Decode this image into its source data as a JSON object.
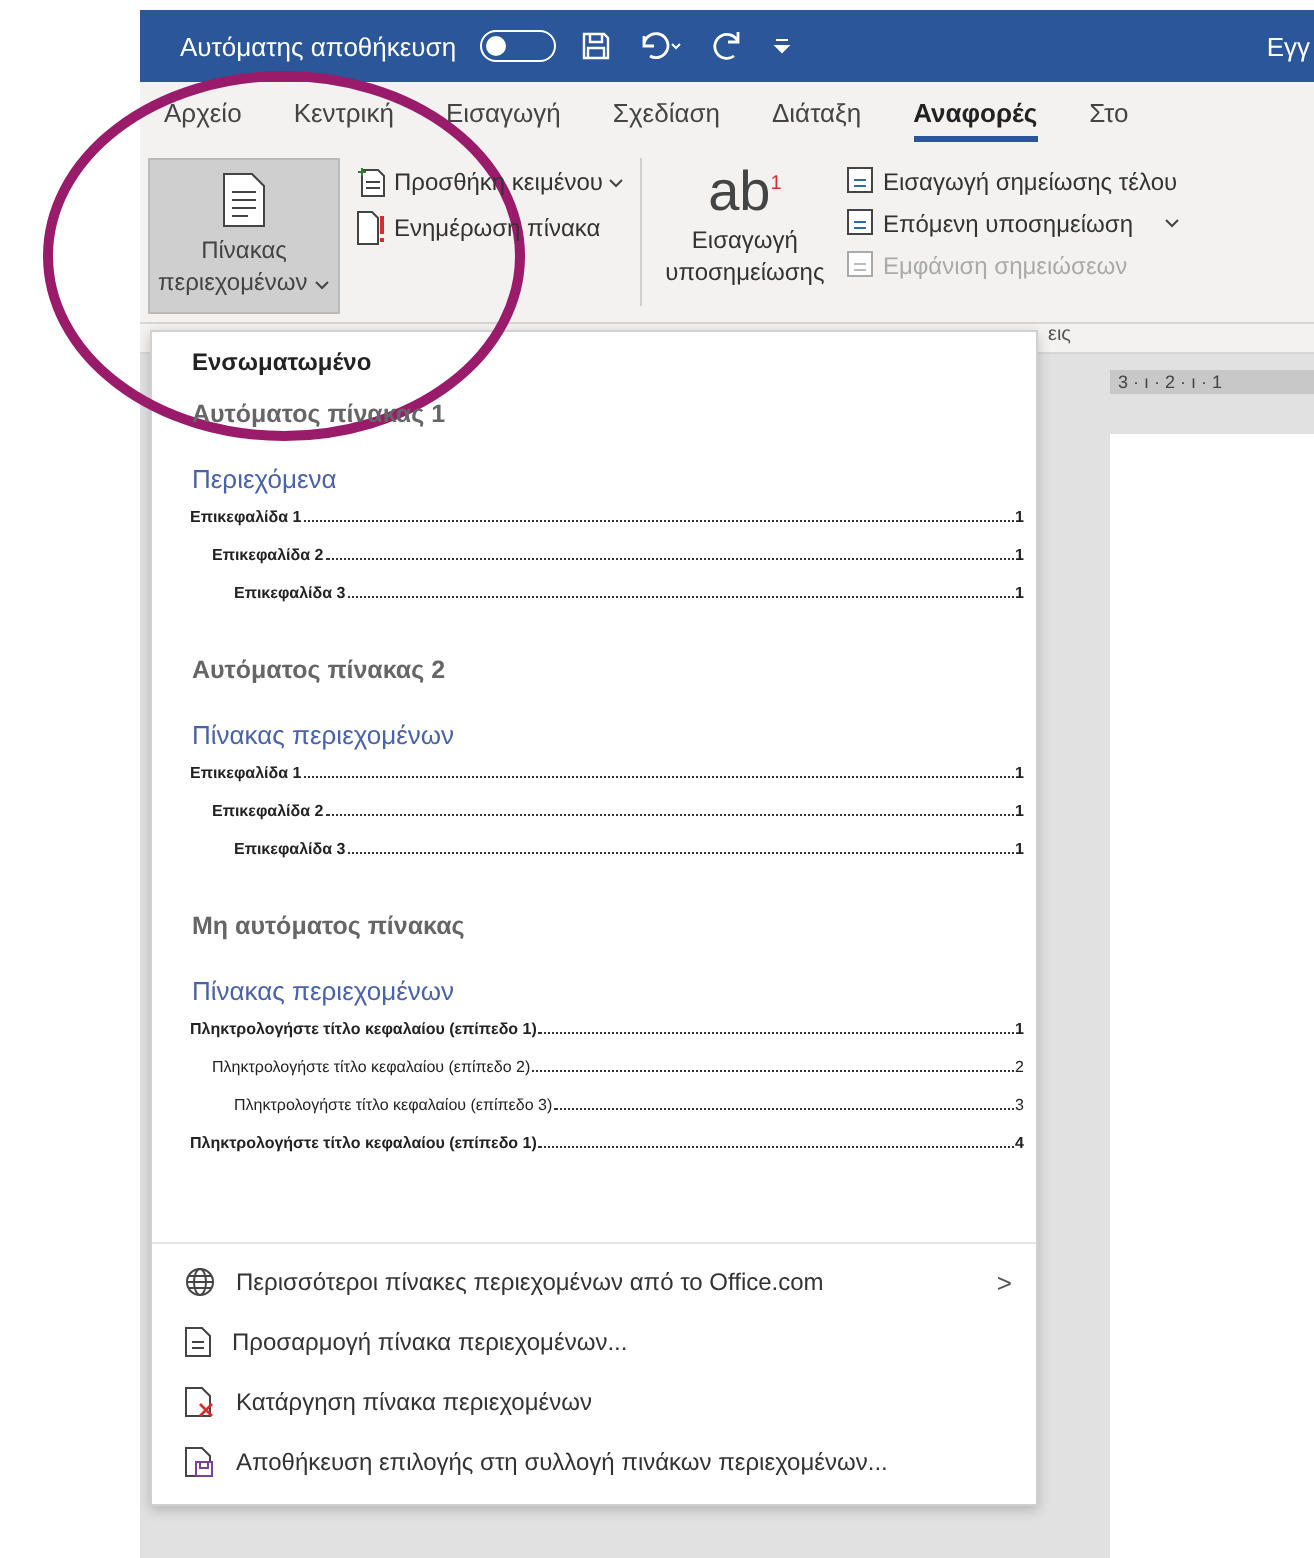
{
  "title_bar": {
    "autosave_label": "Αυτόματης αποθήκευση",
    "autosave_on": false,
    "title": "Εγγ"
  },
  "tabs": [
    {
      "label": "Αρχείο",
      "selected": false
    },
    {
      "label": "Κεντρική",
      "selected": false
    },
    {
      "label": "Εισαγωγή",
      "selected": false
    },
    {
      "label": "Σχεδίαση",
      "selected": false
    },
    {
      "label": "Διάταξη",
      "selected": false
    },
    {
      "label": "Αναφορές",
      "selected": true
    },
    {
      "label": "Στο",
      "selected": false
    }
  ],
  "ribbon": {
    "toc_button": {
      "label": "Πίνακας περιεχομένων",
      "pressed": true
    },
    "add_text": "Προσθήκη κειμένου",
    "update_table": "Ενημέρωση πίνακα",
    "footnote_glyph": "ab",
    "footnote_mark": "1",
    "insert_footnote": "Εισαγωγή υποσημείωσης",
    "small_items": [
      {
        "label": "Εισαγωγή σημείωσης τέλου",
        "disabled": false,
        "dropdown": false
      },
      {
        "label": "Επόμενη υποσημείωση",
        "disabled": false,
        "dropdown": true
      },
      {
        "label": "Εμφάνιση σημειώσεων",
        "disabled": true,
        "dropdown": false
      }
    ],
    "group_label": "εις"
  },
  "ruler": "3 · ı · 2 · ı · 1",
  "menu": {
    "header": "Ενσωματωμένο",
    "styles": [
      {
        "title": "Αυτόματος πίνακας 1",
        "heading": "Περιεχόμενα",
        "entries": [
          {
            "text": "Επικεφαλίδα 1",
            "page": "1",
            "bold": true,
            "children": [
              {
                "text": "Επικεφαλίδα 2",
                "page": "1",
                "bold": true,
                "children": [
                  {
                    "text": "Επικεφαλίδα 3",
                    "page": "1",
                    "bold": true
                  }
                ]
              }
            ]
          }
        ]
      },
      {
        "title": "Αυτόματος πίνακας 2",
        "heading": "Πίνακας περιεχομένων",
        "entries": [
          {
            "text": "Επικεφαλίδα 1",
            "page": "1",
            "bold": true,
            "children": [
              {
                "text": "Επικεφαλίδα 2",
                "page": "1",
                "bold": true,
                "children": [
                  {
                    "text": "Επικεφαλίδα 3",
                    "page": "1",
                    "bold": true
                  }
                ]
              }
            ]
          }
        ]
      },
      {
        "title": "Μη αυτόματος πίνακας",
        "heading": "Πίνακας περιεχομένων",
        "entries": [
          {
            "text": "Πληκτρολογήστε τίτλο κεφαλαίου (επίπεδο 1)",
            "page": "1",
            "bold": true,
            "children": [
              {
                "text": "Πληκτρολογήστε τίτλο κεφαλαίου (επίπεδο 2)",
                "page": "2",
                "bold": false,
                "children": [
                  {
                    "text": "Πληκτρολογήστε τίτλο κεφαλαίου (επίπεδο 3)",
                    "page": "3",
                    "bold": false
                  }
                ]
              }
            ]
          },
          {
            "text": "Πληκτρολογήστε τίτλο κεφαλαίου (επίπεδο 1)",
            "page": "4",
            "bold": true
          }
        ]
      }
    ],
    "actions": [
      {
        "label": "Περισσότεροι πίνακες περιεχομένων από το Office.com",
        "kind": "globe",
        "submenu_glyph": ">"
      },
      {
        "label": "Προσαρμογή πίνακα περιεχομένων...",
        "kind": "doc"
      },
      {
        "label": "Κατάργηση πίνακα περιεχομένων",
        "kind": "remove"
      },
      {
        "label": "Αποθήκευση επιλογής στη συλλογή πινάκων περιεχομένων...",
        "kind": "save"
      }
    ]
  }
}
